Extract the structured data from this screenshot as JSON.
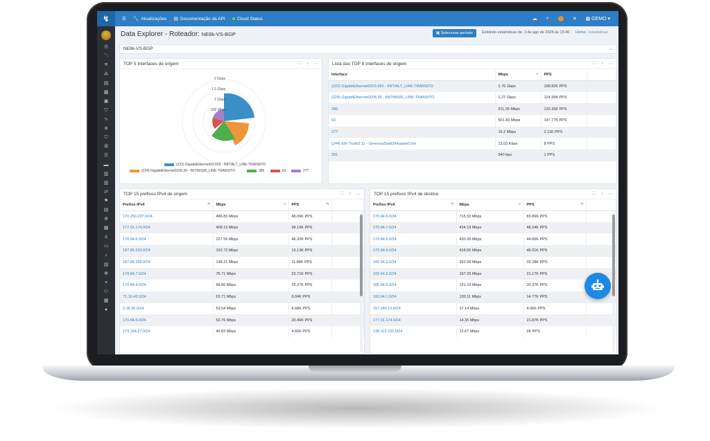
{
  "topbar": {
    "items": [
      "Atualizações",
      "Documentação da API",
      "Cloud Status"
    ],
    "user": "GEMO"
  },
  "page": {
    "title": "Data Explorer - Roteador:",
    "subtitle": "NE8k-VS-BGP",
    "period_button": "Selecionar período",
    "period_text": "Exibindo estatísticas de: 3 de ago de 2026 às 15:40",
    "breadcrumb_home": "Home",
    "breadcrumb_current": "estatísticas",
    "selected_router": "NE8k-VS-BGP"
  },
  "pie_panel": {
    "title": "TOP 5 Interfaces de origem",
    "ticks": [
      "2 Gbps",
      "1.5 Gbps",
      "1 Gbps",
      "500 Mbps"
    ],
    "legend": [
      "(222) GigabitEthernet0/3.650 - INIT/ALT_LINK-TRANSITO",
      "(224) GigabitEthernet0/2/8.39 - INIT/MS00_LINK-TRANSITO",
      "286",
      "63",
      "277"
    ],
    "colors": [
      "#3b8fc9",
      "#f0963a",
      "#4cae4c",
      "#d9534f",
      "#a57fce"
    ]
  },
  "iface_panel": {
    "title": "Lista das TOP 8 Interfaces de origem",
    "headers": [
      "Interface",
      "Mbps",
      "PPS"
    ],
    "rows": [
      [
        "(222) GigabitEthernet0/2/3.650 - INIT/ALT_LINK-TRANSITO",
        "1.76 Gbps",
        "198.82K PPS"
      ],
      [
        "(224) GigabitEthernet0/2/8.39 - INIT/MS00_LINK-TRANSITO",
        "1.27 Gbps",
        "124.99K PPS"
      ],
      [
        "286",
        "911.35 Mbps",
        "129.33K PPS"
      ],
      [
        "63",
        "501.83 Mbps",
        "147.77K PPS"
      ],
      [
        "277",
        "15.2 Mbps",
        "2.11K PPS"
      ],
      [
        "(244) Eth-Trunk3.11 - GerenciaSwitchHuaweiCore",
        "13.03 Kbps",
        "8 PPS"
      ],
      [
        "281",
        "640 bps",
        "1 PPS"
      ]
    ]
  },
  "origin_panel": {
    "title": "TOP 15 prefixos IPv4 de origem",
    "headers": [
      "Prefixo IPv4",
      "Mbps",
      "PPS"
    ],
    "rows": [
      [
        "170.250.237.0/24",
        "486.83 Mbps",
        "48.09K PPS"
      ],
      [
        "177.91.174.0/24",
        "408.13 Mbps",
        "38.19K PPS"
      ],
      [
        "170.84.6.0/24",
        "227.59 Mbps",
        "46.32K PPS"
      ],
      [
        "187.85.152.0/24",
        "152.72 Mbps",
        "13.13K PPS"
      ],
      [
        "187.85.158.0/24",
        "138.21 Mbps",
        "11.88K PPS"
      ],
      [
        "170.84.7.0/24",
        "76.71 Mbps",
        "23.71K PPS"
      ],
      [
        "170.84.4.0/24",
        "68.86 Mbps",
        "25.27K PPS"
      ],
      [
        "71.16.42.0/24",
        "63.71 Mbps",
        "6.04K PPS"
      ],
      [
        "2.18.20.0/24",
        "53.54 Mbps",
        "4.68K PPS"
      ],
      [
        "170.84.5.0/24",
        "52.76 Mbps",
        "20.46K PPS"
      ],
      [
        "173.194.27.0/24",
        "49.83 Mbps",
        "4.66K PPS"
      ]
    ]
  },
  "dest_panel": {
    "title": "TOP 15 prefixos IPv4 de destino",
    "headers": [
      "Prefixo IPv4",
      "Mbps",
      "PPS"
    ],
    "rows": [
      [
        "170.84.6.0/24",
        "715.53 Mbps",
        "83.86K PPS"
      ],
      [
        "170.84.7.0/24",
        "434.19 Mbps",
        "48.34K PPS"
      ],
      [
        "170.84.5.0/24",
        "430.39 Mbps",
        "44.66K PPS"
      ],
      [
        "170.84.4.0/24",
        "418.06 Mbps",
        "46.01K PPS"
      ],
      [
        "100.64.3.0/24",
        "262.59 Mbps",
        "29.28K PPS"
      ],
      [
        "100.64.2.0/24",
        "197.25 Mbps",
        "21.17K PPS"
      ],
      [
        "100.64.0.0/24",
        "191.19 Mbps",
        "20.37K PPS"
      ],
      [
        "100.64.1.0/24",
        "130.11 Mbps",
        "14.77K PPS"
      ],
      [
        "157.240.12.0/24",
        "17.14 Mbps",
        "4.06K PPS"
      ],
      [
        "177.91.174.0/24",
        "14.35 Mbps",
        "21.87K PPS"
      ],
      [
        "138.113.232.0/24",
        "12.67 Mbps",
        "2K PPS"
      ]
    ]
  }
}
